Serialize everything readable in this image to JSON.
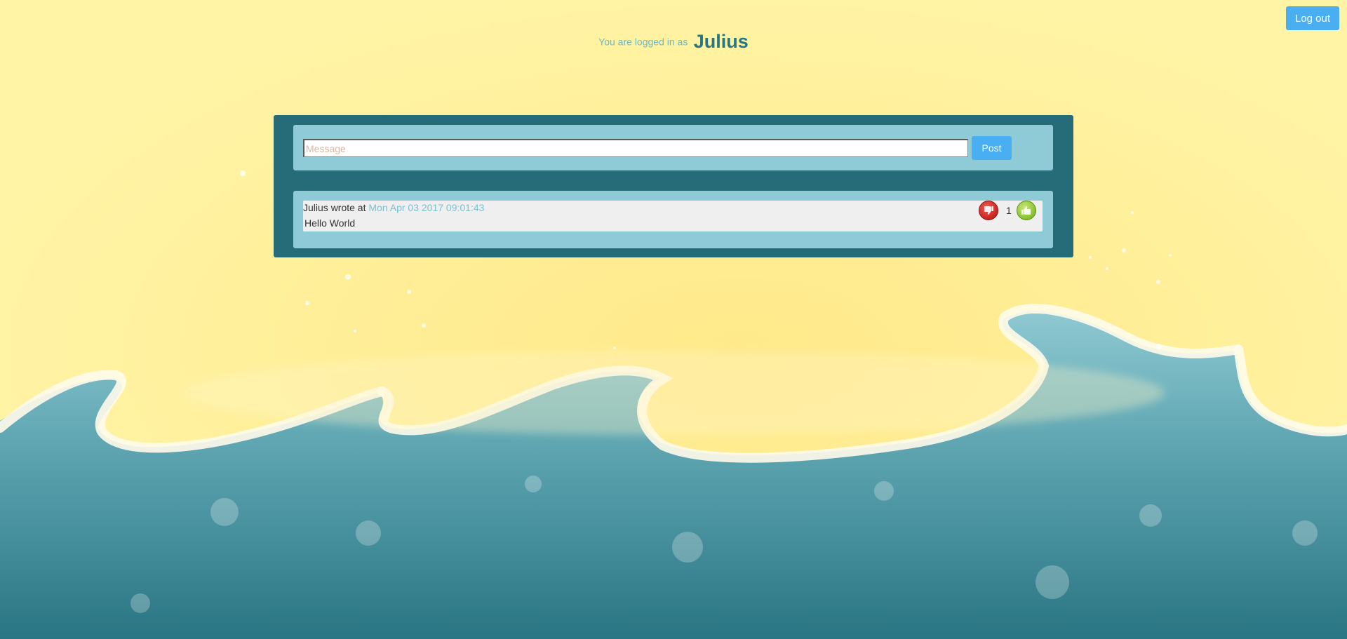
{
  "header": {
    "logged_in_prefix": "You are logged in as",
    "username": "Julius",
    "logout_label": "Log out"
  },
  "compose": {
    "placeholder": "Message",
    "value": "",
    "post_label": "Post"
  },
  "posts": [
    {
      "author": "Julius",
      "wrote_at_label": "wrote at",
      "timestamp": "Mon Apr 03 2017 09:01:43",
      "text": "Hello World",
      "score": "1"
    }
  ],
  "colors": {
    "sand": "#fff3a4",
    "panel": "#266c78",
    "panel_inner": "#8ecbd7",
    "button": "#4aaef2",
    "username": "#277683"
  },
  "icons": {
    "downvote": "thumbs-down-icon",
    "upvote": "thumbs-up-icon"
  }
}
